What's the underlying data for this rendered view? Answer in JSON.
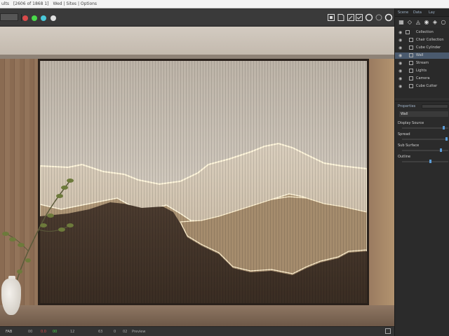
{
  "window": {
    "title_segments": [
      "ults",
      "[2606 of 1868 1]",
      "Wed  |  Sites  |  Options"
    ]
  },
  "toolbar": {
    "field_value": "",
    "status_dots": [
      "#d94a4a",
      "#4ad94a",
      "#4ac8d9",
      "#e0e0e0"
    ],
    "right_icons": [
      "frame-icon",
      "render-icon",
      "edit-icon",
      "camera-icon",
      "circle-icon",
      "circle-outline-icon",
      "ring-icon"
    ]
  },
  "viewport": {
    "scene_colors": {
      "upper_panel": "#cfc8bd",
      "mid_panel": "#b7a38a",
      "lower_panel": "#4a3a2e",
      "glow": "#fff6dc"
    }
  },
  "statusbar": {
    "items": [
      "FAB",
      "00",
      "0.0",
      "00",
      "12",
      "63",
      "0",
      "02",
      "Preview"
    ],
    "colors": [
      "#cccccc",
      "#aaaaaa",
      "#d94a4a",
      "#4ad94a",
      "#aaaaaa",
      "#aaaaaa",
      "#aaaaaa",
      "#aaaaaa",
      "#aaaaaa"
    ]
  },
  "sidepanel": {
    "tabs": [
      "Scene",
      "Data",
      "Lay"
    ],
    "tool_icons": [
      "filter-icon",
      "link-icon",
      "mesh-icon",
      "light-icon",
      "material-icon",
      "world-icon"
    ],
    "outliner": [
      {
        "label": "Collection",
        "selected": false,
        "indent": 0
      },
      {
        "label": "Chair Collection",
        "selected": false,
        "indent": 1
      },
      {
        "label": "Cube Cylinder",
        "selected": false,
        "indent": 1
      },
      {
        "label": "Wall",
        "selected": true,
        "indent": 1
      },
      {
        "label": "Stream",
        "selected": false,
        "indent": 1
      },
      {
        "label": "Lights",
        "selected": false,
        "indent": 1
      },
      {
        "label": "Camera",
        "selected": false,
        "indent": 1
      },
      {
        "label": "Cube Cutter",
        "selected": false,
        "indent": 1
      }
    ],
    "properties": {
      "title": "Properties",
      "field_value": "Wall",
      "rows": [
        {
          "label": "Display Source",
          "value": 0.92
        },
        {
          "label": "Spread",
          "value": 0.98
        },
        {
          "label": "Sub Surface",
          "value": 0.85
        },
        {
          "label": "Outline",
          "value": 0.62
        }
      ]
    }
  }
}
